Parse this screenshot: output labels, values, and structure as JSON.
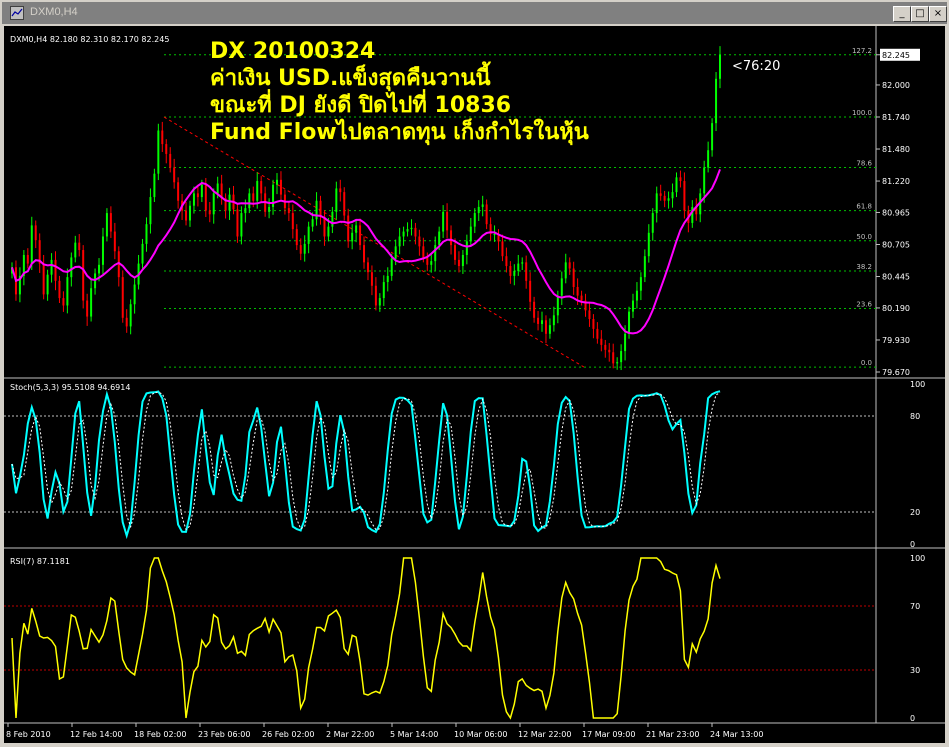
{
  "window": {
    "title": "DXM0,H4",
    "controls": {
      "minimize": "_",
      "maximize": "□",
      "close": "×"
    }
  },
  "chart_header": "DXM0,H4  82.180 82.310 82.170 82.245",
  "overlay_text": [
    "DX 20100324",
    "ค่าเงิน USD.แข็งสุดคืนวานนี้",
    "ขณะที่ DJ ยังดี ปิดไปที่ 10836",
    "Fund Flowไปตลาดทุน เก็งกำไรในหุ้น"
  ],
  "countdown": "<76:20",
  "price_axis": [
    {
      "label": "82.245",
      "value": 82.245,
      "current": true
    },
    {
      "label": "82.000",
      "value": 82.0
    },
    {
      "label": "81.740",
      "value": 81.74
    },
    {
      "label": "81.480",
      "value": 81.48
    },
    {
      "label": "81.220",
      "value": 81.22
    },
    {
      "label": "80.965",
      "value": 80.965
    },
    {
      "label": "80.705",
      "value": 80.705
    },
    {
      "label": "80.445",
      "value": 80.445
    },
    {
      "label": "80.190",
      "value": 80.19
    },
    {
      "label": "79.930",
      "value": 79.93
    },
    {
      "label": "79.670",
      "value": 79.67
    }
  ],
  "fib_levels": [
    {
      "label": "127.2",
      "price": 82.245
    },
    {
      "label": "100.0",
      "price": 81.74
    },
    {
      "label": "78.6",
      "price": 81.33
    },
    {
      "label": "61.8",
      "price": 80.98
    },
    {
      "label": "50.0",
      "price": 80.735
    },
    {
      "label": "38.2",
      "price": 80.49
    },
    {
      "label": "23.6",
      "price": 80.185
    },
    {
      "label": "0.0",
      "price": 79.71
    }
  ],
  "stoch_panel": {
    "label": "Stoch(5,3,3) 95.5108 94.6914",
    "ticks": [
      "100",
      "80",
      "20",
      "0"
    ],
    "levels": [
      80,
      20
    ]
  },
  "rsi_panel": {
    "label": "RSI(7) 87.1181",
    "ticks": [
      "100",
      "70",
      "30",
      "0"
    ],
    "levels": [
      70,
      30
    ]
  },
  "time_axis": [
    "8 Feb 2010",
    "12 Feb 14:00",
    "18 Feb 02:00",
    "23 Feb 06:00",
    "26 Feb 02:00",
    "2 Mar 22:00",
    "5 Mar 14:00",
    "10 Mar 06:00",
    "12 Mar 22:00",
    "17 Mar 09:00",
    "21 Mar 23:00",
    "24 Mar 13:00"
  ],
  "colors": {
    "background": "#000000",
    "bull": "#00ff00",
    "bear": "#ff0000",
    "ma": "#ff00ff",
    "stoch_main": "#00ffff",
    "rsi": "#ffff00",
    "fib": "#00c000",
    "overlay": "#ffff00"
  },
  "chart_data": {
    "type": "candlestick",
    "instrument": "DXM0",
    "timeframe": "H4",
    "ohlc_last": {
      "open": 82.18,
      "high": 82.31,
      "low": 82.17,
      "close": 82.245
    },
    "close": [
      80.52,
      80.3,
      80.45,
      80.62,
      80.55,
      80.86,
      80.74,
      80.55,
      80.3,
      80.46,
      80.58,
      80.41,
      80.27,
      80.21,
      80.44,
      80.6,
      80.72,
      80.66,
      80.25,
      80.12,
      80.35,
      80.47,
      80.54,
      80.77,
      80.96,
      80.81,
      80.65,
      80.44,
      80.11,
      80.04,
      80.22,
      80.38,
      80.55,
      80.71,
      80.87,
      81.09,
      81.28,
      81.63,
      81.52,
      81.44,
      81.33,
      81.21,
      81.06,
      80.98,
      80.9,
      81.02,
      81.12,
      81.09,
      81.19,
      80.98,
      80.95,
      81.12,
      81.2,
      81.08,
      80.98,
      81.11,
      80.99,
      80.77,
      80.96,
      81.0,
      81.12,
      81.06,
      81.22,
      81.12,
      80.97,
      81.01,
      81.19,
      81.23,
      81.11,
      81.0,
      80.96,
      80.83,
      80.7,
      80.63,
      80.71,
      80.85,
      80.91,
      81.06,
      80.93,
      80.77,
      80.85,
      80.97,
      81.16,
      81.13,
      80.94,
      80.73,
      80.8,
      80.86,
      80.7,
      80.56,
      80.48,
      80.37,
      80.21,
      80.27,
      80.4,
      80.45,
      80.59,
      80.69,
      80.77,
      80.81,
      80.83,
      80.84,
      80.77,
      80.69,
      80.6,
      80.54,
      80.57,
      80.7,
      80.81,
      80.97,
      80.82,
      80.7,
      80.58,
      80.53,
      80.62,
      80.73,
      80.85,
      80.96,
      81.01,
      81.03,
      80.87,
      80.79,
      80.79,
      80.73,
      80.61,
      80.53,
      80.45,
      80.49,
      80.55,
      80.56,
      80.41,
      80.24,
      80.11,
      80.06,
      80.09,
      79.98,
      80.05,
      80.13,
      80.29,
      80.43,
      80.56,
      80.51,
      80.36,
      80.29,
      80.25,
      80.17,
      80.1,
      80.02,
      79.94,
      79.89,
      79.85,
      79.83,
      79.74,
      79.75,
      79.84,
      79.98,
      80.16,
      80.25,
      80.33,
      80.44,
      80.61,
      80.8,
      80.96,
      81.12,
      81.1,
      81.06,
      81.08,
      81.13,
      81.25,
      81.22,
      80.98,
      80.88,
      81.01,
      80.95,
      81.12,
      81.33,
      81.47,
      81.69,
      82.05,
      82.245
    ],
    "stoch_main_last": 95.5108,
    "stoch_signal_last": 94.6914,
    "rsi_last": 87.1181,
    "price_range": [
      79.67,
      82.3
    ]
  }
}
